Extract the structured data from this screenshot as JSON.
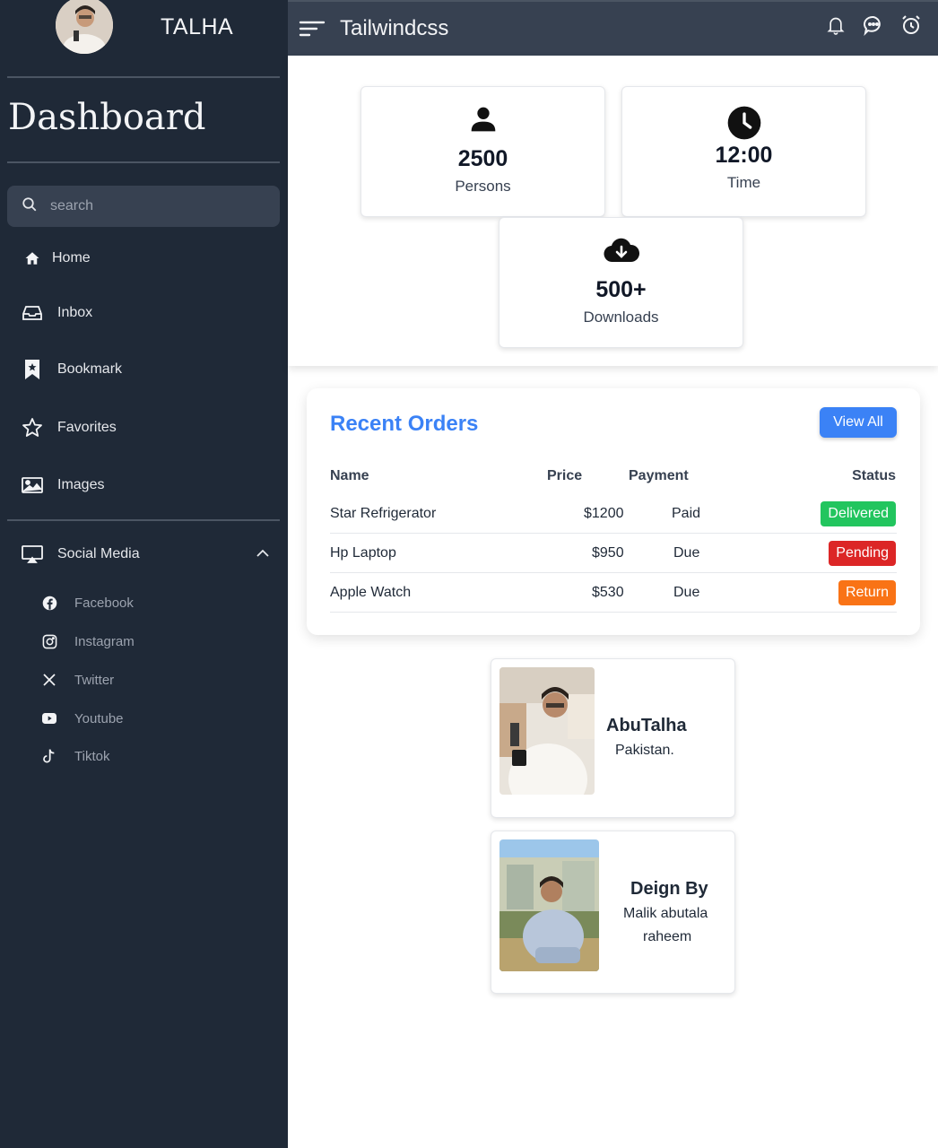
{
  "sidebar": {
    "brand": "TALHA",
    "title": "Dashboard",
    "search_placeholder": "search",
    "items": [
      {
        "label": "Home",
        "icon": "home-icon"
      },
      {
        "label": "Inbox",
        "icon": "inbox-icon"
      },
      {
        "label": "Bookmark",
        "icon": "bookmark-icon"
      },
      {
        "label": "Favorites",
        "icon": "star-icon"
      },
      {
        "label": "Images",
        "icon": "image-icon"
      }
    ],
    "social": {
      "label": "Social Media",
      "icon": "monitor-icon",
      "expanded": true,
      "items": [
        {
          "label": "Facebook",
          "icon": "facebook-icon"
        },
        {
          "label": "Instagram",
          "icon": "instagram-icon"
        },
        {
          "label": "Twitter",
          "icon": "x-twitter-icon"
        },
        {
          "label": "Youtube",
          "icon": "youtube-icon"
        },
        {
          "label": "Tiktok",
          "icon": "tiktok-icon"
        }
      ]
    }
  },
  "topbar": {
    "title": "Tailwindcss",
    "icons": [
      "bell-icon",
      "chat-icon",
      "alarm-clock-icon"
    ]
  },
  "stats": [
    {
      "value": "2500",
      "caption": "Persons",
      "icon": "person-icon"
    },
    {
      "value": "12:00",
      "caption": "Time",
      "icon": "clock-icon"
    },
    {
      "value": "500+",
      "caption": "Downloads",
      "icon": "cloud-download-icon"
    }
  ],
  "orders": {
    "title": "Recent Orders",
    "view_all": "View All",
    "headers": {
      "name": "Name",
      "price": "Price",
      "payment": "Payment",
      "status": "Status"
    },
    "rows": [
      {
        "name": "Star Refrigerator",
        "price": "$1200",
        "payment": "Paid",
        "status": "Delivered",
        "status_color": "#22c55e"
      },
      {
        "name": "Hp Laptop",
        "price": "$950",
        "payment": "Due",
        "status": "Pending",
        "status_color": "#dc2626"
      },
      {
        "name": "Apple Watch",
        "price": "$530",
        "payment": "Due",
        "status": "Return",
        "status_color": "#f97316"
      }
    ]
  },
  "profiles": [
    {
      "name": "AbuTalha",
      "line1": "Pakistan.",
      "line2": ""
    },
    {
      "name": "Deign By",
      "line1": "Malik abutala",
      "line2": "raheem"
    }
  ],
  "colors": {
    "sidebar": "#1f2937",
    "topbar": "#374151",
    "accent": "#3b82f6"
  }
}
